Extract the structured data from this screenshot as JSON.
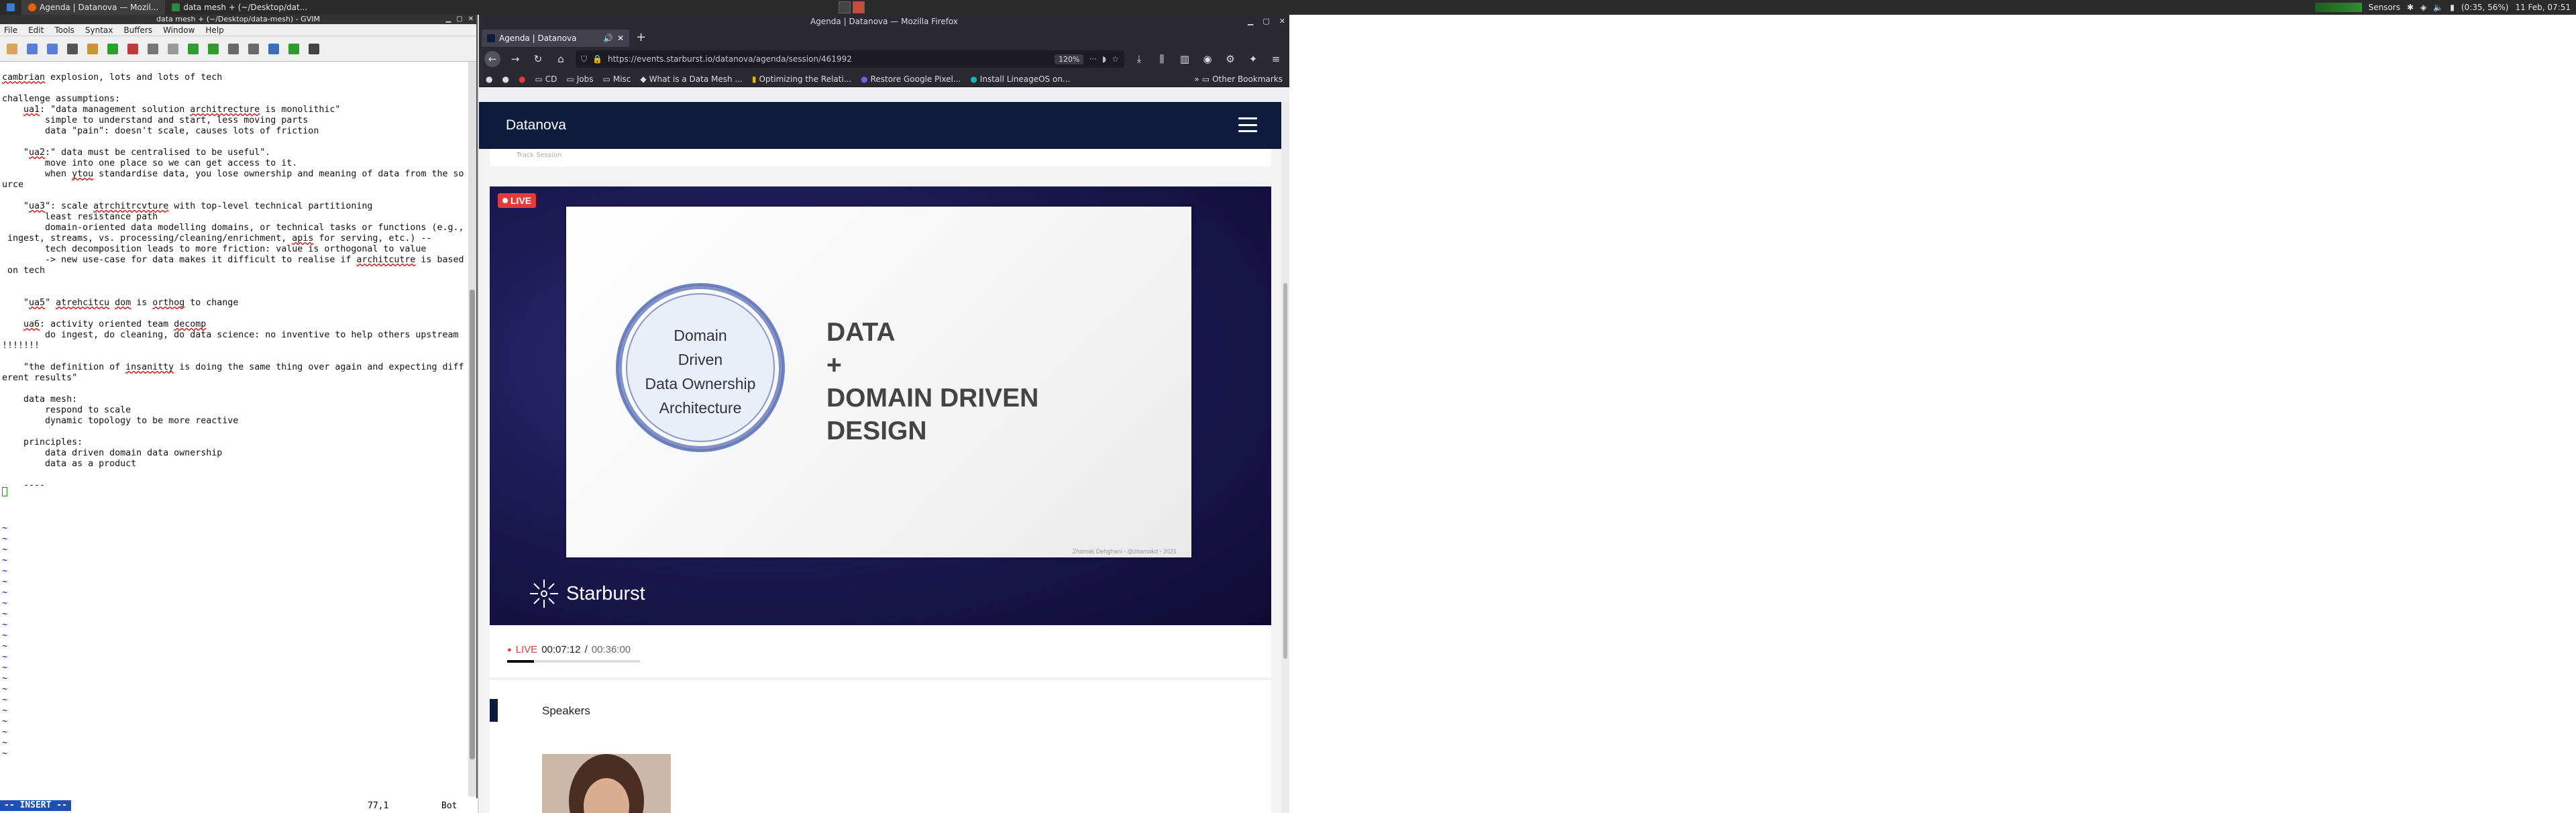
{
  "taskbar": {
    "items": [
      {
        "label": "Agenda | Datanova — Mozil..."
      },
      {
        "label": "data mesh + (~/Desktop/dat..."
      }
    ],
    "tray": {
      "sensors": "Sensors",
      "battery": "(0:35, 56%)",
      "clock": "11 Feb, 07:51"
    }
  },
  "gvim": {
    "title": "data mesh + (~/Desktop/data-mesh) - GVIM",
    "menu": [
      "File",
      "Edit",
      "Tools",
      "Syntax",
      "Buffers",
      "Window",
      "Help"
    ],
    "mode": "-- INSERT --",
    "position": "77,1",
    "scroll": "Bot"
  },
  "firefox": {
    "title": "Agenda | Datanova — Mozilla Firefox",
    "tab_title": "Agenda | Datanova",
    "url": "https://events.starburst.io/datanova/agenda/session/461992",
    "zoom": "120%",
    "bookmarks": [
      {
        "label": "CD"
      },
      {
        "label": "Jobs"
      },
      {
        "label": "Misc"
      },
      {
        "label": "What is a Data Mesh ..."
      },
      {
        "label": "Optimizing the Relati..."
      },
      {
        "label": "Restore Google Pixel..."
      },
      {
        "label": "Install LineageOS on..."
      }
    ],
    "other_bookmarks": "Other Bookmarks"
  },
  "page": {
    "brand": "Datanova",
    "partial_label": "Track Session",
    "live_badge": "LIVE",
    "slide": {
      "circle_line1": "Domain",
      "circle_line2": "Driven",
      "circle_line3": "Data Ownership",
      "circle_line4": "Architecture",
      "text_line1": "DATA",
      "text_line2": "+",
      "text_line3": "DOMAIN DRIVEN",
      "text_line4": "DESIGN",
      "credit": "Zhamak Dehghani - @zhamakd - 2021"
    },
    "video_logo": "Starburst",
    "player": {
      "live": "LIVE",
      "elapsed": "00:07:12",
      "separator": "/",
      "total": "00:36:00",
      "progress_fraction": 0.2
    },
    "speakers_title": "Speakers"
  }
}
